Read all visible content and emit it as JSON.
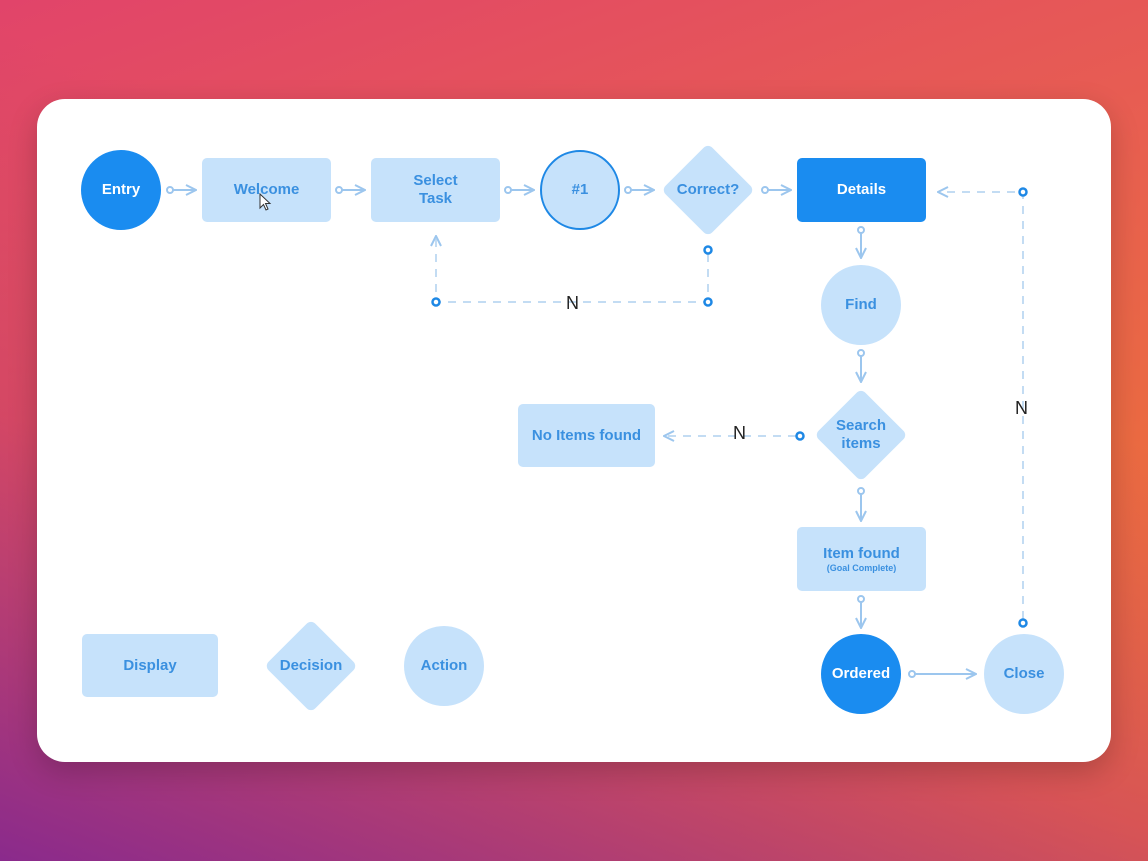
{
  "colors": {
    "primary": "#1a8cf0",
    "light": "#c6e2fb",
    "text": "#3a90e0",
    "connector": "#9cc6ee"
  },
  "nodes": {
    "entry": "Entry",
    "welcome": "Welcome",
    "select_task_1": "Select",
    "select_task_2": "Task",
    "step1": "#1",
    "correct": "Correct?",
    "details": "Details",
    "find": "Find",
    "search_1": "Search",
    "search_2": "items",
    "no_items": "No Items found",
    "item_found": "Item found",
    "item_found_sub": "(Goal Complete)",
    "ordered": "Ordered",
    "close": "Close"
  },
  "legend": {
    "display": "Display",
    "decision": "Decision",
    "action": "Action"
  },
  "edge_labels": {
    "correct_no": "N",
    "search_no": "N",
    "close_no": "N"
  }
}
